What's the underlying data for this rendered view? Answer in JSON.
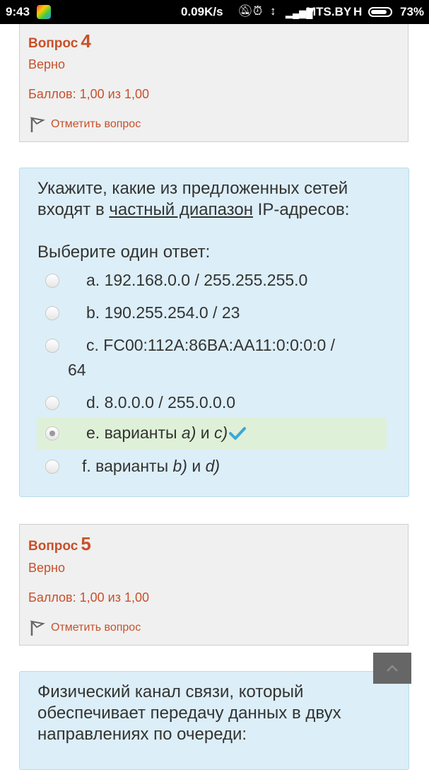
{
  "status_bar": {
    "time": "9:43",
    "speed": "0.09K/s",
    "carrier": "MTS.BY",
    "network": "H",
    "battery": "73%"
  },
  "question4_info": {
    "label": "Вопрос",
    "number": "4",
    "state": "Верно",
    "grade": "Баллов: 1,00 из 1,00",
    "flag_label": "Отметить вопрос"
  },
  "question4": {
    "text_before": "Укажите, какие из предложенных сетей входят в ",
    "text_underlined": "частный диапазон",
    "text_after": " IP-адресов:",
    "prompt": "Выберите один ответ:",
    "options": [
      {
        "label": "a. 192.168.0.0 / 255.255.255.0"
      },
      {
        "label": "b. 190.255.254.0 / 23"
      },
      {
        "label": "c. FC00:112A:86BA:AA11:0:0:0:0 /",
        "continuation": "64"
      },
      {
        "label": "d. 8.0.0.0 / 255.0.0.0"
      },
      {
        "label_prefix": "e. варианты ",
        "em1": "a)",
        "mid": " и ",
        "em2": "c)",
        "selected": true
      },
      {
        "label_prefix": "f. варианты ",
        "em1": "b)",
        "mid": " и ",
        "em2": "d)"
      }
    ]
  },
  "question5_info": {
    "label": "Вопрос",
    "number": "5",
    "state": "Верно",
    "grade": "Баллов: 1,00 из 1,00",
    "flag_label": "Отметить вопрос"
  },
  "question5": {
    "text": "Физический канал связи, который обеспечивает передачу данных в двух направлениях по очереди:"
  },
  "colors": {
    "accent": "#c8502a",
    "question_bg": "#dceef7",
    "info_bg": "#f0f0f0",
    "selected_bg": "#dff0d8",
    "correct_tick": "#3aa7d8"
  }
}
